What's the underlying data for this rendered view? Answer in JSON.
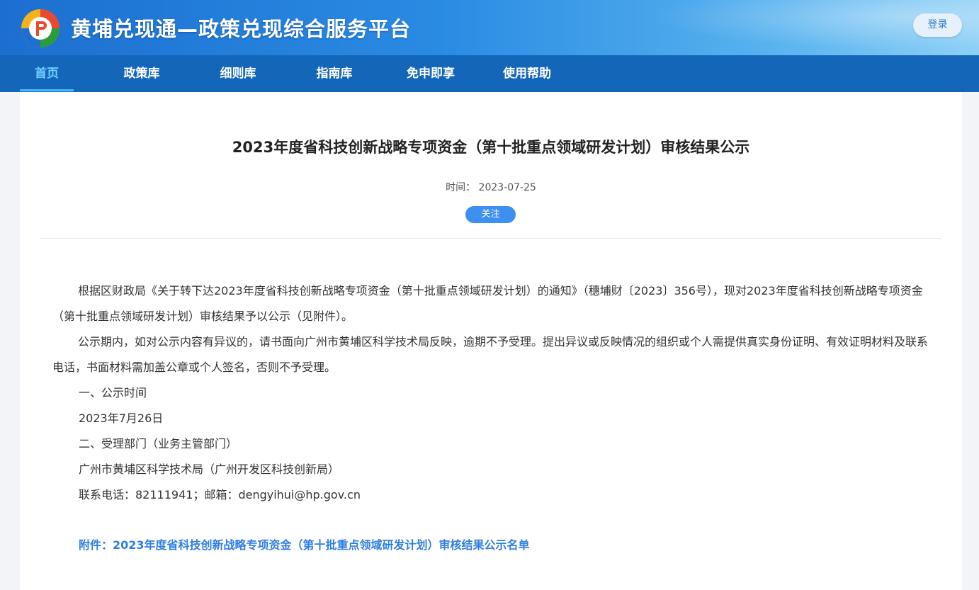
{
  "header": {
    "site_title": "黄埔兑现通—政策兑现综合服务平台",
    "login_label": "登录",
    "logo_icon": "hp-logo-icon"
  },
  "nav": {
    "items": [
      {
        "label": "首页",
        "active": true
      },
      {
        "label": "政策库"
      },
      {
        "label": "细则库"
      },
      {
        "label": "指南库"
      },
      {
        "label": "免申即享"
      },
      {
        "label": "使用帮助"
      }
    ]
  },
  "article": {
    "title": "2023年度省科技创新战略专项资金（第十批重点领域研发计划）审核结果公示",
    "time_label": "时间：",
    "time_value": "2023-07-25",
    "follow_label": "关注",
    "paragraphs": [
      "根据区财政局《关于转下达2023年度省科技创新战略专项资金（第十批重点领域研发计划）的通知》（穗埔财〔2023〕356号），现对2023年度省科技创新战略专项资金（第十批重点领域研发计划）审核结果予以公示（见附件）。",
      "公示期内，如对公示内容有异议的，请书面向广州市黄埔区科学技术局反映，逾期不予受理。提出异议或反映情况的组织或个人需提供真实身份证明、有效证明材料及联系电话，书面材料需加盖公章或个人签名，否则不予受理。"
    ],
    "lines": [
      "一、公示时间",
      "2023年7月26日",
      "二、受理部门（业务主管部门）",
      "广州市黄埔区科学技术局（广州开发区科技创新局）",
      "联系电话：82111941；邮箱：dengyihui@hp.gov.cn"
    ],
    "attachment": "附件：2023年度省科技创新战略专项资金（第十批重点领域研发计划）审核结果公示名单"
  },
  "colors": {
    "nav_bg": "#1466b8",
    "nav_active": "#6fd0ff",
    "follow_btn": "#3d8ff0",
    "link": "#2f7ee0"
  }
}
